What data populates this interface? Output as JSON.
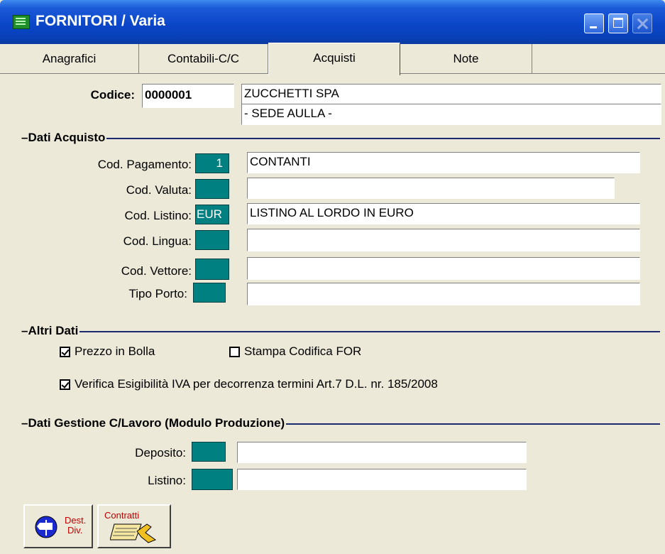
{
  "window": {
    "title": "FORNITORI / Varia",
    "app_icon": "table-icon",
    "controls": [
      "minimize",
      "maximize",
      "close"
    ]
  },
  "tabs": [
    {
      "label": "Anagrafici",
      "active": false
    },
    {
      "label": "Contabili-C/C",
      "active": false
    },
    {
      "label": "Acquisti",
      "active": true
    },
    {
      "label": "Note",
      "active": false
    }
  ],
  "header": {
    "codice_label": "Codice:",
    "codice_value": "0000001",
    "ragione_sociale_1": "ZUCCHETTI SPA",
    "ragione_sociale_2": "- SEDE AULLA -"
  },
  "dati_acquisto": {
    "title": "Dati Acquisto",
    "pagamento": {
      "label": "Cod. Pagamento:",
      "code": "1",
      "desc": "CONTANTI"
    },
    "valuta": {
      "label": "Cod. Valuta:",
      "code": "",
      "desc": ""
    },
    "listino": {
      "label": "Cod. Listino:",
      "code": "EUR",
      "desc": "LISTINO AL LORDO IN EURO"
    },
    "lingua": {
      "label": "Cod. Lingua:",
      "code": "",
      "desc": ""
    },
    "vettore": {
      "label": "Cod. Vettore:",
      "code": "",
      "desc": ""
    },
    "porto": {
      "label": "Tipo Porto:",
      "code": "",
      "desc": ""
    }
  },
  "altri_dati": {
    "title": "Altri Dati",
    "prezzo_in_bolla": {
      "label": "Prezzo in Bolla",
      "checked": true
    },
    "stampa_codifica": {
      "label": "Stampa Codifica FOR",
      "checked": false
    },
    "verifica_iva": {
      "label": "Verifica Esigibilità IVA per decorrenza termini Art.7 D.L. nr. 185/2008",
      "checked": true
    }
  },
  "gestione_lavoro": {
    "title": "Dati Gestione C/Lavoro (Modulo Produzione)",
    "deposito": {
      "label": "Deposito:",
      "code": "",
      "desc": ""
    },
    "listino": {
      "label": "Listino:",
      "code": "",
      "desc": ""
    }
  },
  "buttons": {
    "dest_div_line1": "Dest.",
    "dest_div_line2": "Div.",
    "contratti": "Contratti"
  },
  "colors": {
    "code_field": "#008080",
    "section_rule": "#1a2a6e",
    "titlebar": "#0a46c8"
  }
}
